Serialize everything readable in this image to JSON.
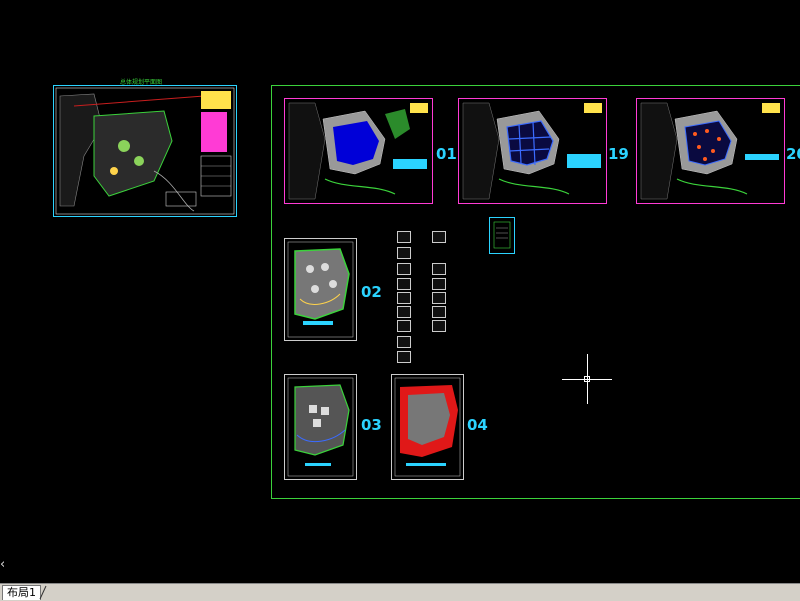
{
  "layout_tabs": [
    {
      "label": "布局1"
    }
  ],
  "master_sheet": {
    "title": "总体规划平面图"
  },
  "sheets": [
    {
      "number": "01"
    },
    {
      "number": "19"
    },
    {
      "number": "20"
    },
    {
      "number": "02"
    },
    {
      "number": "03"
    },
    {
      "number": "04"
    }
  ],
  "colors": {
    "sheet_number": "#2bd3ff",
    "frame": "#3bd23b",
    "background": "#000000"
  },
  "icons": {
    "scroll_left": "chevron-left-icon",
    "crosshair": "crosshair-cursor-icon"
  }
}
